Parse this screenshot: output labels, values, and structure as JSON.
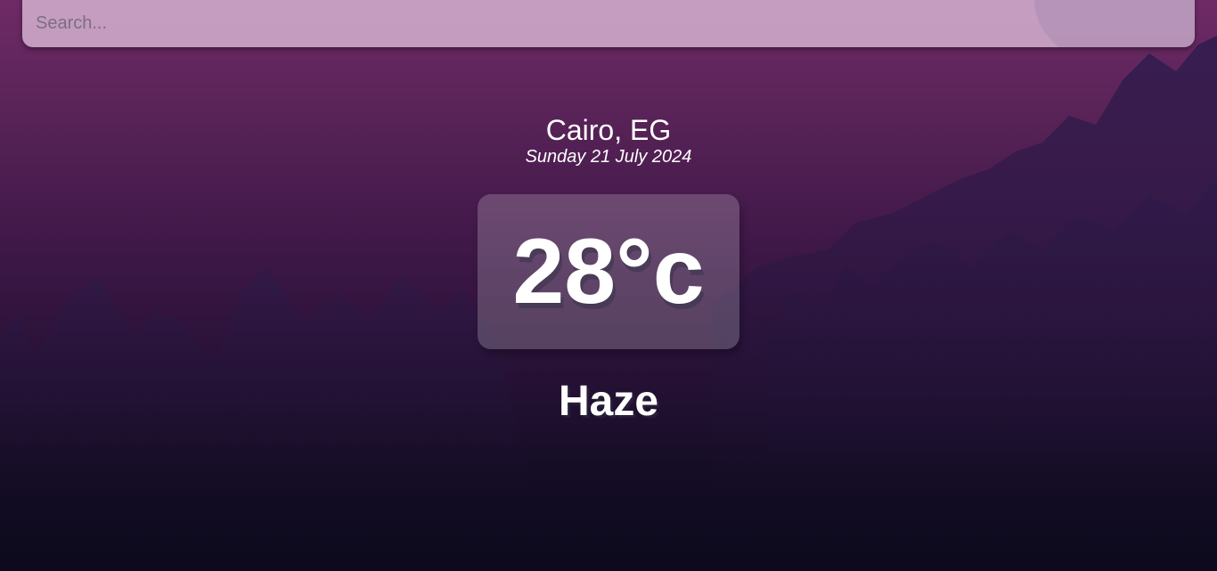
{
  "search": {
    "placeholder": "Search...",
    "value": ""
  },
  "location": {
    "city_country": "Cairo, EG",
    "date": "Sunday 21 July 2024"
  },
  "weather": {
    "temperature": "28°c",
    "condition": "Haze"
  },
  "colors": {
    "background_top": "#6e2a66",
    "background_bottom": "#0c0a1c",
    "text": "#ffffff"
  }
}
